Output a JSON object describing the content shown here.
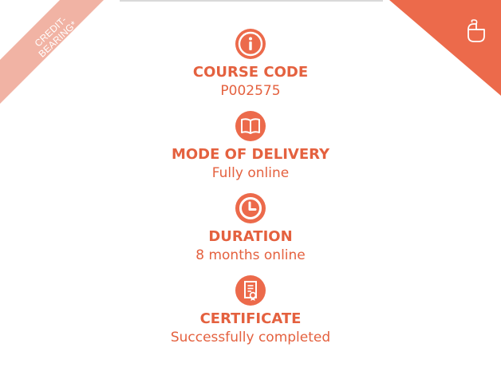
{
  "ribbon": {
    "line1": "CREDIT-",
    "line2": "BEARING*"
  },
  "colors": {
    "accent": "#ec6a4b",
    "text": "#e4613f",
    "ribbon_light": "#f1b3a4"
  },
  "corner_icon": "mouse-icon",
  "items": [
    {
      "icon": "info-icon",
      "label": "COURSE CODE",
      "value": "P002575"
    },
    {
      "icon": "book-icon",
      "label": "MODE OF DELIVERY",
      "value": "Fully online"
    },
    {
      "icon": "clock-icon",
      "label": "DURATION",
      "value": "8 months online"
    },
    {
      "icon": "certificate-icon",
      "label": "CERTIFICATE",
      "value": "Successfully completed"
    }
  ]
}
